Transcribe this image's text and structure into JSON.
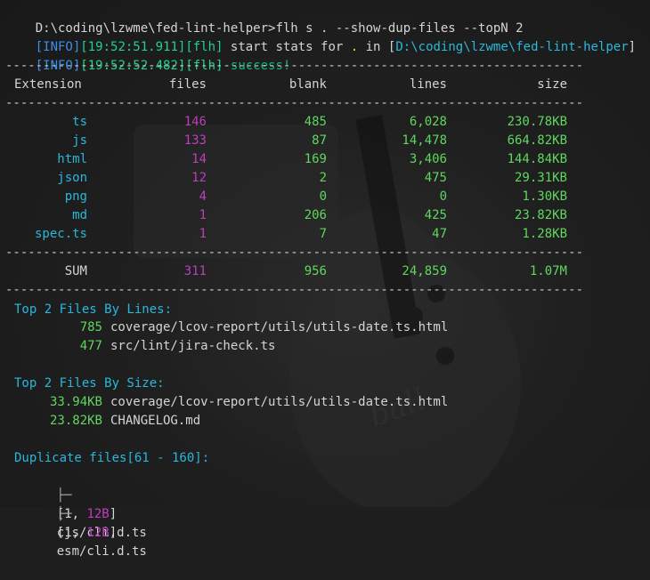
{
  "prompt": "D:\\coding\\lzwme\\fed-lint-helper>flh s . --show-dup-files --topN 2",
  "log1": {
    "level": "[INFO]",
    "time": "[19:52:51.911]",
    "tag": "[flh]",
    "msg": " start stats for ",
    "dot": ".",
    "in": " in [",
    "path": "D:\\coding\\lzwme\\fed-lint-helper",
    "close": "]"
  },
  "log2": {
    "level": "[INFO]",
    "time": "[19:52:52.482]",
    "tag": "[flh]",
    "msg": " success!"
  },
  "separator": "-----------------------------------------------------------------------------",
  "table": {
    "headers": [
      "Extension",
      "files",
      "blank",
      "lines",
      "size"
    ],
    "rows": [
      [
        "ts",
        "146",
        "485",
        "6,028",
        "230.78KB"
      ],
      [
        "js",
        "133",
        "87",
        "14,478",
        "664.82KB"
      ],
      [
        "html",
        "14",
        "169",
        "3,406",
        "144.84KB"
      ],
      [
        "json",
        "12",
        "2",
        "475",
        "29.31KB"
      ],
      [
        "png",
        "4",
        "0",
        "0",
        "1.30KB"
      ],
      [
        "md",
        "1",
        "206",
        "425",
        "23.82KB"
      ],
      [
        "spec.ts",
        "1",
        "7",
        "47",
        "1.28KB"
      ]
    ],
    "sum": [
      "SUM",
      "311",
      "956",
      "24,859",
      "1.07M"
    ]
  },
  "top_lines": {
    "title": "Top 2 Files By Lines:",
    "items": [
      {
        "value": "785",
        "file": "coverage/lcov-report/utils/utils-date.ts.html"
      },
      {
        "value": "477",
        "file": "src/lint/jira-check.ts"
      }
    ]
  },
  "top_size": {
    "title": "Top 2 Files By Size:",
    "items": [
      {
        "value": "33.94KB",
        "file": "coverage/lcov-report/utils/utils-date.ts.html"
      },
      {
        "value": "23.82KB",
        "file": "CHANGELOG.md"
      }
    ]
  },
  "dup": {
    "title": "Duplicate files[61 - 160]:",
    "items": [
      {
        "tree": "├─",
        "open": "[",
        "count": "1",
        "comma": ", ",
        "size": "12B",
        "close": "]",
        "file": "cjs/cli.d.ts"
      },
      {
        "tree": "├─",
        "open": "[",
        "count": "1",
        "comma": ", ",
        "size": "12B",
        "close": "]",
        "file": "esm/cli.d.ts"
      }
    ]
  }
}
